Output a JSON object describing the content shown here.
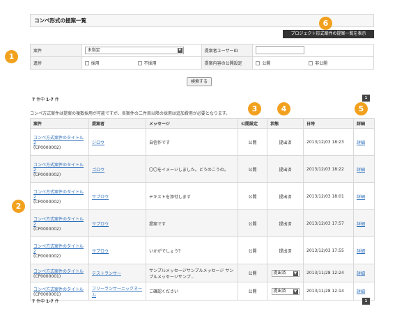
{
  "title": "コンペ形式の提案一覧",
  "show_project_button": "プロジェクト形式案件の提案一覧を表示",
  "filter": {
    "case_label": "案件",
    "case_value": "未指定",
    "user_id_label": "提案者ユーザーID",
    "progress_label": "進捗",
    "progress_opts": [
      "採用",
      "不採用"
    ],
    "public_label": "提案内容の公開設定",
    "public_opts": [
      "公開",
      "非公開"
    ]
  },
  "search_button": "検索する",
  "count_top": {
    "total": "7",
    "sep": " 件中 ",
    "range": "1-7",
    "unit": " 件"
  },
  "count_bottom": {
    "total": "7",
    "sep": " 件中 ",
    "range": "1-7",
    "unit": " 件"
  },
  "page": "1",
  "note": "コンペ方式案件は提案の複数採用が可能ですが、各案件の二件目以降の採用は追加費用が必要となります。",
  "columns": [
    "案件",
    "提案者",
    "メッセージ",
    "公開設定",
    "状態",
    "日時",
    "詳細"
  ],
  "rows": [
    {
      "case": "コンペ方式案件のタイトル2",
      "code": "(CP0000002)",
      "proposer": "ジロウ",
      "message": "自信作です",
      "public": "公開",
      "status": "提出済",
      "dropdown": false,
      "date": "2013/12/03 18:23",
      "detail": "詳細"
    },
    {
      "case": "コンペ方式案件のタイトル2",
      "code": "(CP0000002)",
      "proposer": "ゴロウ",
      "message": "〇〇をイメージしました。どうのこうの。",
      "public": "公開",
      "status": "提出済",
      "dropdown": false,
      "date": "2013/12/03 18:22",
      "detail": "詳細"
    },
    {
      "case": "コンペ方式案件のタイトル2",
      "code": "(CP0000002)",
      "proposer": "サブロウ",
      "message": "テキストを添付します",
      "public": "公開",
      "status": "提出済",
      "dropdown": false,
      "date": "2013/12/03 18:01",
      "detail": "詳細"
    },
    {
      "case": "コンペ方式案件のタイトル2",
      "code": "(CP0000002)",
      "proposer": "サブロウ",
      "message": "提案です",
      "public": "公開",
      "status": "提出済",
      "dropdown": false,
      "date": "2013/12/03 17:57",
      "detail": "詳細"
    },
    {
      "case": "コンペ方式案件のタイトル2",
      "code": "(CP0000002)",
      "proposer": "サブロウ",
      "message": "いかがでしょう？",
      "public": "公開",
      "status": "提出済",
      "dropdown": false,
      "date": "2013/12/03 17:55",
      "detail": "詳細"
    },
    {
      "case": "コンペ方式案件のタイトル",
      "code": "(CP0000001)",
      "proposer": "テストランサー",
      "message": "サンプルメッセージサンプルメッセージ サンプルメッセージサンプ...",
      "public": "公開",
      "status": "提出済",
      "dropdown": true,
      "date": "2013/11/28 12:24",
      "detail": "詳細"
    },
    {
      "case": "コンペ方式案件のタイトル",
      "code": "(CP0000001)",
      "proposer": "フリーランサーニックネーム",
      "message": "ご確認ください",
      "public": "公開",
      "status": "提出済",
      "dropdown": true,
      "date": "2013/11/28 12:14",
      "detail": "詳細"
    }
  ],
  "badges": [
    "1",
    "2",
    "3",
    "4",
    "5",
    "6"
  ],
  "colors": {
    "badge": "#f2a11f",
    "link": "#2a6dbb",
    "dark_button": "#333333"
  }
}
